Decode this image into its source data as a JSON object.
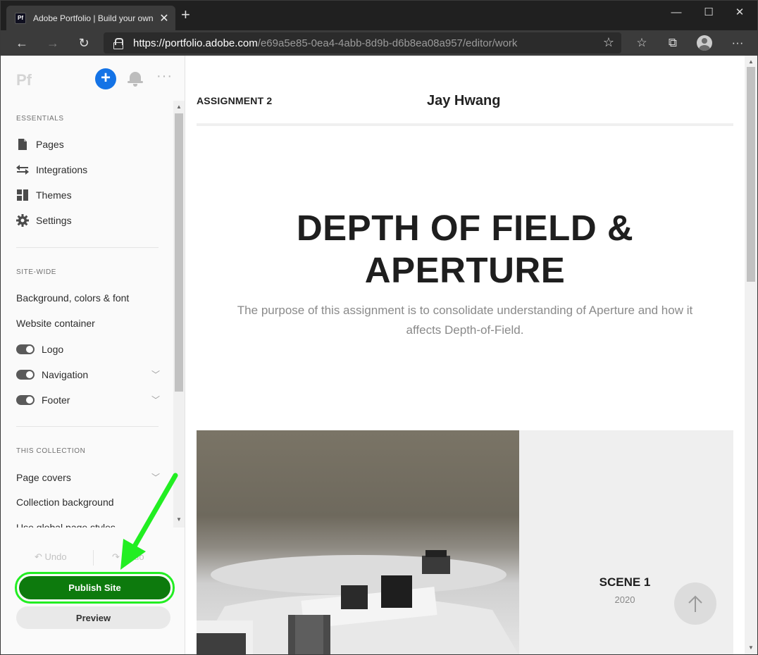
{
  "browser": {
    "tab_title": "Adobe Portfolio | Build your own",
    "favicon_text": "Pf",
    "url_host": "https://portfolio.adobe.com",
    "url_path": "/e69a5e85-0ea4-4abb-8d9b-d6b8ea08a957/editor/work",
    "icons": [
      "back-icon",
      "forward-icon",
      "refresh-icon",
      "lock-icon",
      "favorite-star-icon",
      "favorites-list-icon",
      "collections-icon",
      "profile-icon",
      "more-icon"
    ]
  },
  "sidebar": {
    "logo": "Pf",
    "essentials_label": "ESSENTIALS",
    "essentials": [
      {
        "label": "Pages",
        "icon": "page-icon"
      },
      {
        "label": "Integrations",
        "icon": "swap-arrows-icon"
      },
      {
        "label": "Themes",
        "icon": "grid-icon"
      },
      {
        "label": "Settings",
        "icon": "gear-icon"
      }
    ],
    "sitewide_label": "SITE-WIDE",
    "sitewide": {
      "background": "Background, colors & font",
      "container": "Website container",
      "logo_toggle": "Logo",
      "navigation_toggle": "Navigation",
      "footer_toggle": "Footer"
    },
    "collection_label": "THIS COLLECTION",
    "collection": {
      "page_covers": "Page covers",
      "background": "Collection background",
      "partial": "Use global page styles"
    },
    "undo": "Undo",
    "redo": "Redo",
    "publish": "Publish Site",
    "preview": "Preview"
  },
  "page": {
    "assignment": "ASSIGNMENT 2",
    "author": "Jay Hwang",
    "title_line1": "DEPTH OF FIELD &",
    "title_line2": "APERTURE",
    "description_line1": "The purpose of this assignment is to consolidate understanding of Aperture and how it",
    "description_line2": "affects Depth-of-Field.",
    "scene_title": "SCENE 1",
    "scene_year": "2020"
  },
  "colors": {
    "publish_green": "#0d7a0d",
    "highlight_green": "#22ee22",
    "add_button_blue": "#1473e6"
  }
}
